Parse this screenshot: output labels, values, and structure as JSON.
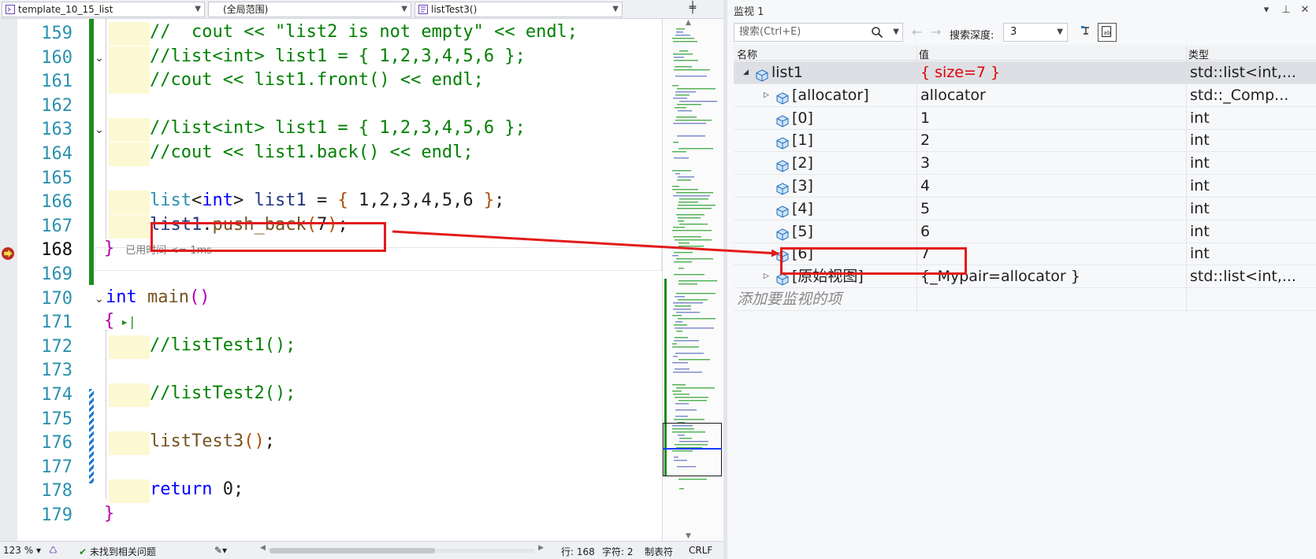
{
  "nav_bar": {
    "project": "template_10_15_list",
    "scope": "(全局范围)",
    "function": "listTest3()"
  },
  "code_lines": [
    {
      "num": "159",
      "tokens": [
        {
          "t": "//  cout << \"list2 is not empty\" << endl;",
          "c": "c-com"
        }
      ]
    },
    {
      "num": "160",
      "tokens": [
        {
          "t": "//list<int> list1 = { 1,2,3,4,5,6 };",
          "c": "c-com"
        }
      ]
    },
    {
      "num": "161",
      "tokens": [
        {
          "t": "//cout << list1.front() << endl;",
          "c": "c-com"
        }
      ]
    },
    {
      "num": "162",
      "tokens": []
    },
    {
      "num": "163",
      "tokens": [
        {
          "t": "//list<int> list1 = { 1,2,3,4,5,6 };",
          "c": "c-com"
        }
      ]
    },
    {
      "num": "164",
      "tokens": [
        {
          "t": "//cout << list1.back() << endl;",
          "c": "c-com"
        }
      ]
    },
    {
      "num": "165",
      "tokens": []
    },
    {
      "num": "166",
      "tokens": [
        {
          "t": "list",
          "c": "c-type"
        },
        {
          "t": "<",
          "c": "c-txt"
        },
        {
          "t": "int",
          "c": "c-kw"
        },
        {
          "t": "> ",
          "c": "c-txt"
        },
        {
          "t": "list1",
          "c": "c-var"
        },
        {
          "t": " = ",
          "c": "c-txt"
        },
        {
          "t": "{",
          "c": "c-brace"
        },
        {
          "t": " ",
          "c": "c-txt"
        },
        {
          "t": "1,2,3,4,5,6",
          "c": "c-txt"
        },
        {
          "t": " ",
          "c": "c-txt"
        },
        {
          "t": "}",
          "c": "c-brace"
        },
        {
          "t": ";",
          "c": "c-txt"
        }
      ]
    },
    {
      "num": "167",
      "tokens": [
        {
          "t": "list1",
          "c": "c-var"
        },
        {
          "t": ".",
          "c": "c-txt"
        },
        {
          "t": "push_back",
          "c": "c-fn"
        },
        {
          "t": "(",
          "c": "c-brace"
        },
        {
          "t": "7",
          "c": "c-txt"
        },
        {
          "t": ")",
          "c": "c-brace"
        },
        {
          "t": ";",
          "c": "c-txt"
        }
      ]
    },
    {
      "num": "168",
      "tokens": [
        {
          "t": "}",
          "c": "c-br"
        }
      ]
    },
    {
      "num": "169",
      "tokens": []
    },
    {
      "num": "170",
      "tokens": [
        {
          "t": "int",
          "c": "c-kw"
        },
        {
          "t": " ",
          "c": "c-txt"
        },
        {
          "t": "main",
          "c": "c-fn"
        },
        {
          "t": "()",
          "c": "c-br"
        }
      ]
    },
    {
      "num": "171",
      "tokens": [
        {
          "t": "{",
          "c": "c-br"
        }
      ]
    },
    {
      "num": "172",
      "tokens": [
        {
          "t": "//listTest1();",
          "c": "c-com"
        }
      ]
    },
    {
      "num": "173",
      "tokens": []
    },
    {
      "num": "174",
      "tokens": [
        {
          "t": "//listTest2();",
          "c": "c-com"
        }
      ]
    },
    {
      "num": "175",
      "tokens": []
    },
    {
      "num": "176",
      "tokens": [
        {
          "t": "listTest3",
          "c": "c-fn"
        },
        {
          "t": "()",
          "c": "c-brace"
        },
        {
          "t": ";",
          "c": "c-txt"
        }
      ]
    },
    {
      "num": "177",
      "tokens": []
    },
    {
      "num": "178",
      "tokens": [
        {
          "t": "return",
          "c": "c-kw"
        },
        {
          "t": " ",
          "c": "c-txt"
        },
        {
          "t": "0",
          "c": "c-txt"
        },
        {
          "t": ";",
          "c": "c-txt"
        }
      ]
    },
    {
      "num": "179",
      "tokens": [
        {
          "t": "}",
          "c": "c-br"
        }
      ]
    }
  ],
  "elapsed_hint": "已用时间 <= 1ms",
  "status_bar": {
    "zoom": "123 %",
    "issues": "未找到相关问题",
    "line": "行: 168",
    "char": "字符: 2",
    "indent": "制表符",
    "eol": "CRLF"
  },
  "watch": {
    "title": "监视 1",
    "search_placeholder": "搜索(Ctrl+E)",
    "depth_label": "搜索深度:",
    "depth_value": "3",
    "headers": {
      "name": "名称",
      "value": "值",
      "type": "类型"
    },
    "rows": [
      {
        "name": "list1",
        "value": "{ size=7 }",
        "type": "std::list<int,..."
      },
      {
        "name": "[allocator]",
        "value": "allocator",
        "type": "std::_Comp..."
      },
      {
        "name": "[0]",
        "value": "1",
        "type": "int"
      },
      {
        "name": "[1]",
        "value": "2",
        "type": "int"
      },
      {
        "name": "[2]",
        "value": "3",
        "type": "int"
      },
      {
        "name": "[3]",
        "value": "4",
        "type": "int"
      },
      {
        "name": "[4]",
        "value": "5",
        "type": "int"
      },
      {
        "name": "[5]",
        "value": "6",
        "type": "int"
      },
      {
        "name": "[6]",
        "value": "7",
        "type": "int"
      },
      {
        "name": "[原始视图]",
        "value": "{_Mypair=allocator }",
        "type": "std::list<int,..."
      }
    ],
    "add_item_placeholder": "添加要监视的项"
  },
  "colors": {
    "annotation_red": "#e21b1b",
    "changed_value": "#e00000",
    "change_bar_green": "#1e8e1e"
  }
}
